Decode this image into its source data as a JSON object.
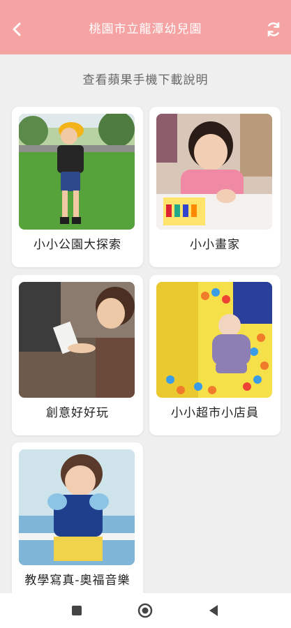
{
  "header": {
    "title": "桃園市立龍潭幼兒園",
    "back_icon": "chevron-left-icon",
    "refresh_icon": "refresh-icon",
    "background": "#f6a3a3"
  },
  "help_link": "查看蘋果手機下載說明",
  "albums": [
    {
      "label": "小小公園大探索",
      "photo": "child in yellow hat on grass"
    },
    {
      "label": "小小畫家",
      "photo": "child drawing with markers"
    },
    {
      "label": "創意好好玩",
      "photo": "child playing with paper"
    },
    {
      "label": "小小超市小店員",
      "photo": "baby in ball pit"
    },
    {
      "label": "教學寫真-奧福音樂",
      "photo": "child in costume at playground"
    }
  ],
  "nav": {
    "recent_icon": "square-icon",
    "home_icon": "circle-icon",
    "back_icon": "triangle-back-icon"
  }
}
